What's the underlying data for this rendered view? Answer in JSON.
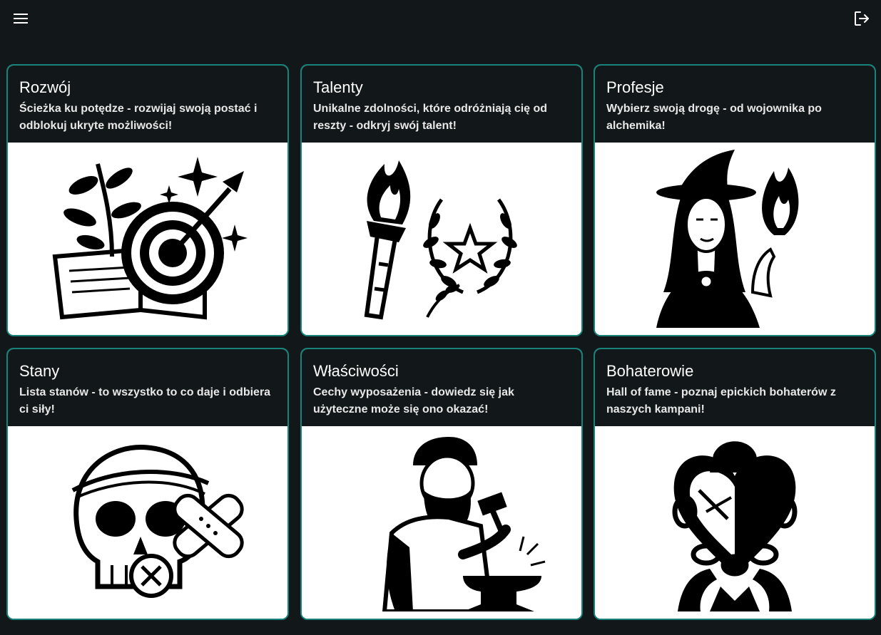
{
  "topbar": {
    "menu_icon": "menu-icon",
    "logout_icon": "logout-icon"
  },
  "cards": [
    {
      "title": "Rozwój",
      "description": "Ścieżka ku potędze - rozwijaj swoją postać i odblokuj ukryte możliwości!",
      "image_icon": "growth-target-illustration"
    },
    {
      "title": "Talenty",
      "description": "Unikalne zdolności, które odróżniają cię od reszty - odkryj swój talent!",
      "image_icon": "torch-laurel-illustration"
    },
    {
      "title": "Profesje",
      "description": "Wybierz swoją drogę - od wojownika po alchemika!",
      "image_icon": "witch-illustration"
    },
    {
      "title": "Stany",
      "description": "Lista stanów - to wszystko to co daje i odbiera ci siły!",
      "image_icon": "skull-bandage-illustration"
    },
    {
      "title": "Właściwości",
      "description": "Cechy wyposażenia - dowiedz się jak użyteczne może się ono okazać!",
      "image_icon": "blacksmith-illustration"
    },
    {
      "title": "Bohaterowie",
      "description": "Hall of fame - poznaj epickich bohaterów z naszych kampani!",
      "image_icon": "heart-chain-illustration"
    }
  ],
  "colors": {
    "background": "#121719",
    "card_border": "#17837a",
    "text": "#ffffff"
  }
}
